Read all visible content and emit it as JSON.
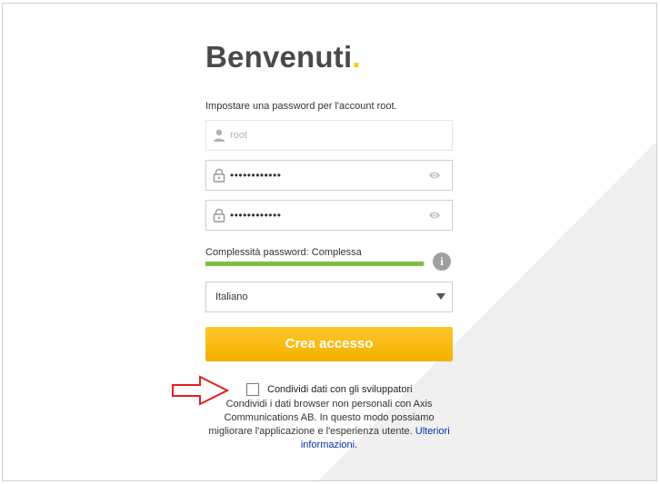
{
  "welcome": {
    "title": "Benvenuti",
    "title_dot": "."
  },
  "form": {
    "instruction": "Impostare una password per l'account root.",
    "username_value": "root",
    "password_mask": "••••••••••••",
    "confirm_mask": "••••••••••••",
    "strength_label": "Complessità password: Complessa",
    "strength_fraction": 0.99,
    "strength_color": "#7fbf3f",
    "info_glyph": "i",
    "language_selected": "Italiano",
    "submit_label": "Crea accesso"
  },
  "consent": {
    "checkbox_label": "Condividi dati con gli sviluppatori",
    "checked": false,
    "description": "Condividi i dati browser non personali con Axis Communications AB. In questo modo possiamo migliorare l'applicazione e l'esperienza utente.",
    "link_text": "Ulteriori informazioni."
  },
  "annotation": {
    "arrow_color": "#e02020"
  },
  "theme": {
    "accent": "#ffcc00",
    "button": "#f5b800"
  },
  "icons": [
    "user-icon",
    "lock-icon",
    "eye-icon",
    "info-icon",
    "caret-down-icon"
  ]
}
